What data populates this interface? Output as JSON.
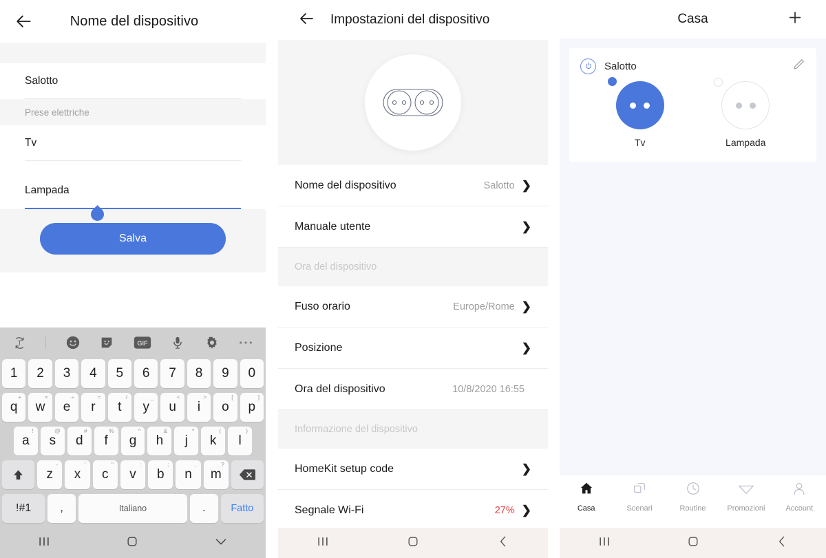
{
  "panel1": {
    "header": {
      "back_icon": "back-arrow-icon",
      "title": "Nome del dispositivo"
    },
    "fields": [
      {
        "value": "Salotto",
        "focused": false
      },
      {
        "value": "Tv",
        "focused": false
      },
      {
        "value": "Lampada",
        "focused": true
      }
    ],
    "section_label": "Prese elettriche",
    "save_label": "Salva",
    "keyboard": {
      "toolbar_icons": [
        "translate-icon",
        "emoji-icon",
        "sticker-icon",
        "gif-icon",
        "microphone-icon",
        "gear-icon",
        "more-icon"
      ],
      "gif_label": "GIF",
      "row1": [
        "1",
        "2",
        "3",
        "4",
        "5",
        "6",
        "7",
        "8",
        "9",
        "0"
      ],
      "row2": [
        {
          "key": "q",
          "alt": "+"
        },
        {
          "key": "w",
          "alt": "×"
        },
        {
          "key": "e",
          "alt": "÷"
        },
        {
          "key": "r",
          "alt": "="
        },
        {
          "key": "t",
          "alt": "/"
        },
        {
          "key": "y",
          "alt": "_"
        },
        {
          "key": "u",
          "alt": "<"
        },
        {
          "key": "i",
          "alt": ">"
        },
        {
          "key": "o",
          "alt": "["
        },
        {
          "key": "p",
          "alt": "]"
        }
      ],
      "row3": [
        {
          "key": "a",
          "alt": "!"
        },
        {
          "key": "s",
          "alt": "@"
        },
        {
          "key": "d",
          "alt": "#"
        },
        {
          "key": "f",
          "alt": "%"
        },
        {
          "key": "g",
          "alt": "^"
        },
        {
          "key": "h",
          "alt": "&"
        },
        {
          "key": "j",
          "alt": "*"
        },
        {
          "key": "k",
          "alt": "("
        },
        {
          "key": "l",
          "alt": ")"
        }
      ],
      "row4": [
        {
          "key": "z",
          "alt": "-"
        },
        {
          "key": "x",
          "alt": "'"
        },
        {
          "key": "c",
          "alt": "\""
        },
        {
          "key": "v",
          "alt": ":"
        },
        {
          "key": "b",
          "alt": ";"
        },
        {
          "key": "n",
          "alt": ","
        },
        {
          "key": "m",
          "alt": "?"
        }
      ],
      "shift_icon": "shift-up-icon",
      "backspace_icon": "backspace-icon",
      "symbols_label": "!#1",
      "comma_label": ",",
      "space_label": "Italiano",
      "period_label": ".",
      "done_label": "Fatto"
    },
    "navbar": [
      "recents-icon",
      "home-icon",
      "hide-keyboard-icon"
    ]
  },
  "panel2": {
    "header": {
      "back_icon": "back-arrow-icon",
      "title": "Impostazioni del dispositivo"
    },
    "hero_icon": "dual-socket-icon",
    "rows": [
      {
        "type": "row",
        "label": "Nome del dispositivo",
        "value": "Salotto",
        "chevron": true
      },
      {
        "type": "row",
        "label": "Manuale utente",
        "value": "",
        "chevron": true
      },
      {
        "type": "heading",
        "label": "Ora del dispositivo"
      },
      {
        "type": "row",
        "label": "Fuso orario",
        "value": "Europe/Rome",
        "chevron": true
      },
      {
        "type": "row",
        "label": "Posizione",
        "value": "",
        "chevron": true
      },
      {
        "type": "row",
        "label": "Ora del dispositivo",
        "value": "10/8/2020 16:55",
        "chevron": false
      },
      {
        "type": "heading",
        "label": "Informazione del dispositivo"
      },
      {
        "type": "row",
        "label": "HomeKit setup code",
        "value": "",
        "chevron": true
      },
      {
        "type": "row",
        "label": "Segnale Wi-Fi",
        "value": "27%",
        "chevron": true,
        "warn": true
      }
    ],
    "navbar": [
      "recents-icon",
      "home-icon",
      "back-icon"
    ]
  },
  "panel3": {
    "header": {
      "title": "Casa",
      "add_icon": "plus-icon"
    },
    "room": {
      "power_icon": "power-icon",
      "name": "Salotto",
      "edit_icon": "pencil-icon",
      "devices": [
        {
          "name": "Tv",
          "state": "on"
        },
        {
          "name": "Lampada",
          "state": "off"
        }
      ]
    },
    "tabs": [
      {
        "label": "Casa",
        "icon": "home-icon",
        "active": true
      },
      {
        "label": "Scenari",
        "icon": "scenes-icon",
        "active": false
      },
      {
        "label": "Routine",
        "icon": "clock-icon",
        "active": false
      },
      {
        "label": "Promozioni",
        "icon": "diamond-icon",
        "active": false
      },
      {
        "label": "Account",
        "icon": "person-icon",
        "active": false
      }
    ],
    "navbar": [
      "recents-icon",
      "home-icon",
      "back-icon"
    ]
  },
  "colors": {
    "accent": "#4a77db",
    "warn": "#e24444",
    "done": "#3b82f6"
  }
}
